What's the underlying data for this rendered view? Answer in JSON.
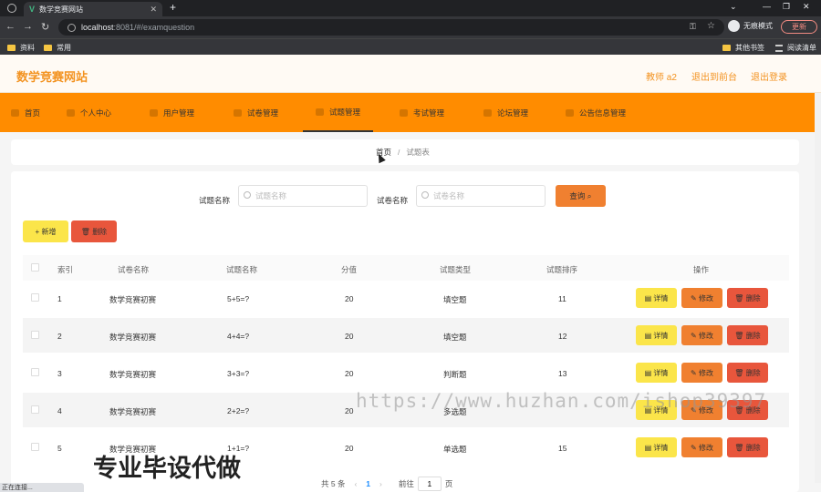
{
  "browser": {
    "tab_title": "数学竞赛网站",
    "url_host": "localhost",
    "url_rest": ":8081/#/examquestion",
    "profile_label": "无痕模式",
    "update_label": "更新",
    "bookmarks": [
      "资料",
      "常用"
    ],
    "bookmarks_right": [
      "其他书签",
      "阅读清单"
    ],
    "status": "正在连接..."
  },
  "header": {
    "title": "数学竞赛网站",
    "user": "教师 a2",
    "back_front": "退出到前台",
    "logout": "退出登录"
  },
  "nav": {
    "items": [
      "首页",
      "个人中心",
      "用户管理",
      "试卷管理",
      "试题管理",
      "考试管理",
      "论坛管理",
      "公告信息管理"
    ],
    "active": "试题管理"
  },
  "breadcrumb": {
    "home": "首页",
    "sep": "/",
    "current": "试题表"
  },
  "search": {
    "question_label": "试题名称",
    "question_placeholder": "试题名称",
    "paper_label": "试卷名称",
    "paper_placeholder": "试卷名称",
    "query_label": "查询"
  },
  "actions": {
    "add": "+ 新增",
    "delete": "删除"
  },
  "table": {
    "headers": [
      "索引",
      "试卷名称",
      "试题名称",
      "分值",
      "试题类型",
      "试题排序",
      "操作"
    ],
    "rows": [
      {
        "index": "1",
        "paper": "数学竞赛初赛",
        "question": "5+5=?",
        "score": "20",
        "type": "填空题",
        "order": "11"
      },
      {
        "index": "2",
        "paper": "数学竞赛初赛",
        "question": "4+4=?",
        "score": "20",
        "type": "填空题",
        "order": "12"
      },
      {
        "index": "3",
        "paper": "数学竞赛初赛",
        "question": "3+3=?",
        "score": "20",
        "type": "判断题",
        "order": "13"
      },
      {
        "index": "4",
        "paper": "数学竞赛初赛",
        "question": "2+2=?",
        "score": "20",
        "type": "多选题",
        "order": ""
      },
      {
        "index": "5",
        "paper": "数学竞赛初赛",
        "question": "1+1=?",
        "score": "20",
        "type": "单选题",
        "order": "15"
      }
    ],
    "op_detail": "详情",
    "op_edit": "修改",
    "op_delete": "删除"
  },
  "pager": {
    "total": "共 5 条",
    "current": "1",
    "goto_label": "前往",
    "goto_value": "1",
    "page_unit": "页"
  },
  "watermark": {
    "url": "https://www.huzhan.com/ishop39397",
    "text": "专业毕设代做"
  }
}
